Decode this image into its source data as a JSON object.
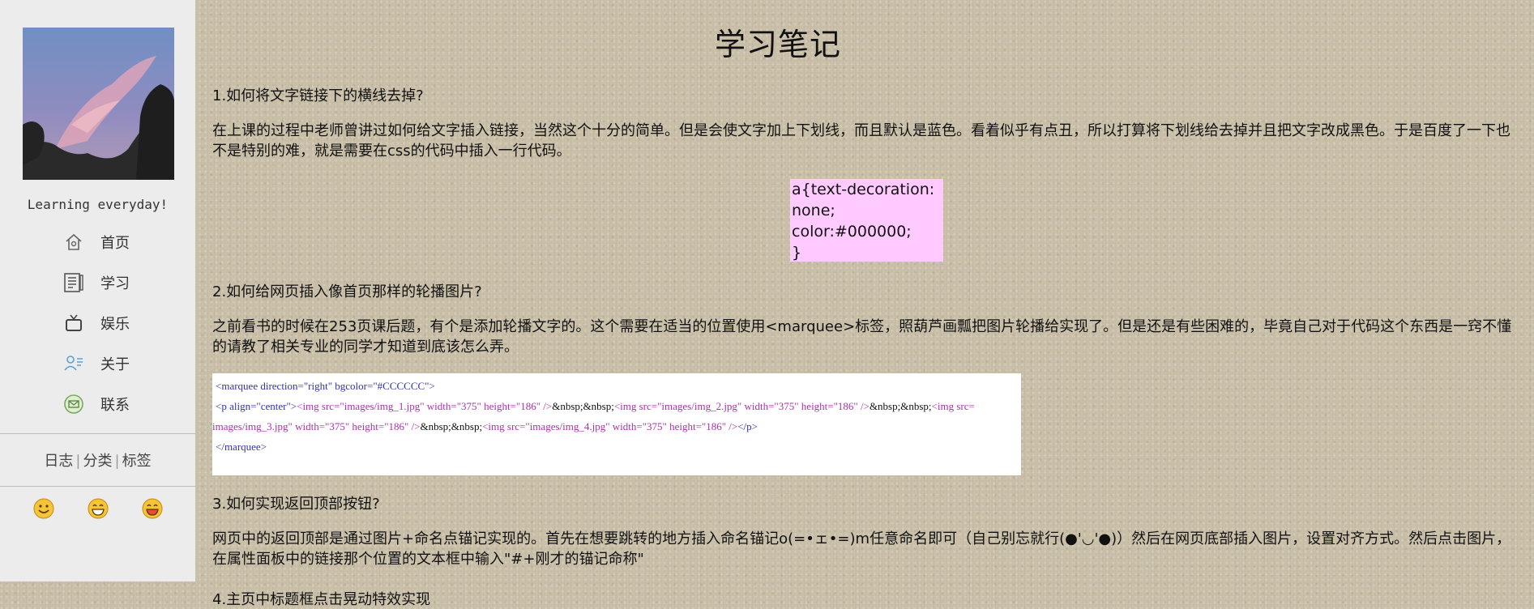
{
  "sidebar": {
    "motto": "Learning everyday!",
    "nav": [
      {
        "label": "首页",
        "icon": "home-icon"
      },
      {
        "label": "学习",
        "icon": "notebook-icon"
      },
      {
        "label": "娱乐",
        "icon": "tv-icon"
      },
      {
        "label": "关于",
        "icon": "user-icon"
      },
      {
        "label": "联系",
        "icon": "contact-icon"
      }
    ],
    "links": [
      "日志",
      "分类",
      "标签"
    ],
    "emojis": [
      "smile-emoji",
      "grin-emoji",
      "happy-emoji"
    ]
  },
  "main": {
    "title": "学习笔记",
    "q1": "1.如何将文字链接下的横线去掉?",
    "p1": "在上课的过程中老师曾讲过如何给文字插入链接，当然这个十分的简单。但是会使文字加上下划线，而且默认是蓝色。看着似乎有点丑，所以打算将下划线给去掉并且把文字改成黑色。于是百度了一下也不是特别的难，就是需要在css的代码中插入一行代码。",
    "code1": [
      "a{text-decoration:",
      "none;",
      "color:#000000;",
      "}"
    ],
    "q2": "2.如何给网页插入像首页那样的轮播图片?",
    "p2": "之前看书的时候在253页课后题，有个是添加轮播文字的。这个需要在适当的位置使用<marquee>标签，照葫芦画瓢把图片轮播给实现了。但是还是有些困难的，毕竟自己对于代码这个东西是一窍不懂的请教了相关专业的同学才知道到底该怎么弄。",
    "code2": {
      "line1_tag": "<marquee direction=\"right\" bgcolor=\"#CCCCCC\">",
      "line2_p": "<p align=\"center\">",
      "line2_img1": "<img src=\"images/img_1.jpg\" width=\"375\" height=\"186\" />",
      "nbsp": "&nbsp;&nbsp;",
      "line2_img2": "<img src=\"images/img_2.jpg\" width=\"375\" height=\"186\" />",
      "line2_img3_start": "<img src=",
      "line3_img3_end": "images/img_3.jpg\" width=\"375\" height=\"186\" />",
      "line3_img4": "<img src=\"images/img_4.jpg\" width=\"375\" height=\"186\" />",
      "line3_pclose": "</p>",
      "line4_tag": "</marquee>"
    },
    "q3": "3.如何实现返回顶部按钮?",
    "p3": "网页中的返回顶部是通过图片+命名点锚记实现的。首先在想要跳转的地方插入命名锚记o(=•ェ•=)m任意命名即可（自己别忘就行(●'◡'●)）然后在网页底部插入图片，设置对齐方式。然后点击图片，在属性面板中的链接那个位置的文本框中输入\"#+刚才的锚记命称\"",
    "q4": "4.主页中标题框点击晃动特效实现"
  }
}
